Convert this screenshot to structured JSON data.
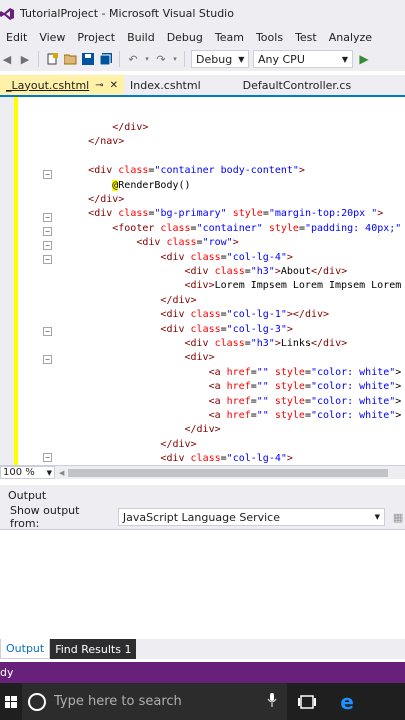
{
  "window": {
    "title": "TutorialProject - Microsoft Visual Studio"
  },
  "menu": [
    "Edit",
    "View",
    "Project",
    "Build",
    "Debug",
    "Team",
    "Tools",
    "Test",
    "Analyze"
  ],
  "toolbar": {
    "config": "Debug",
    "platform": "Any CPU",
    "icons": [
      "back-icon",
      "forward-icon",
      "new-project-icon",
      "open-icon",
      "save-icon",
      "save-all-icon",
      "undo-icon",
      "redo-icon",
      "start-icon"
    ]
  },
  "tabs": [
    {
      "label": "_Layout.cshtml",
      "pin": "⊸",
      "close": "✕"
    },
    {
      "label": "Index.cshtml"
    },
    {
      "label": "DefaultController.cs"
    }
  ],
  "code": [
    [
      [
        "tx",
        "            "
      ],
      [
        "tg",
        "</div>"
      ]
    ],
    [
      [
        "tx",
        "        "
      ],
      [
        "tg",
        "</nav>"
      ]
    ],
    [
      [
        "tx",
        ""
      ]
    ],
    [
      [
        "tx",
        "        "
      ],
      [
        "tg",
        "<div "
      ],
      [
        "at",
        "class"
      ],
      [
        "tx",
        "="
      ],
      [
        "av",
        "\"container body-content\""
      ],
      [
        "tg",
        ">"
      ]
    ],
    [
      [
        "tx",
        "            "
      ],
      [
        "rz",
        "@"
      ],
      [
        "tx",
        "RenderBody()"
      ]
    ],
    [
      [
        "tx",
        "        "
      ],
      [
        "tg",
        "</div>"
      ]
    ],
    [
      [
        "tx",
        "        "
      ],
      [
        "tg",
        "<div "
      ],
      [
        "at",
        "class"
      ],
      [
        "tx",
        "="
      ],
      [
        "av",
        "\"bg-primary\""
      ],
      [
        "tx",
        " "
      ],
      [
        "at",
        "style"
      ],
      [
        "tx",
        "="
      ],
      [
        "av",
        "\"margin-top:20px \""
      ],
      [
        "tg",
        ">"
      ]
    ],
    [
      [
        "tx",
        "            "
      ],
      [
        "tg",
        "<footer "
      ],
      [
        "at",
        "class"
      ],
      [
        "tx",
        "="
      ],
      [
        "av",
        "\"container\""
      ],
      [
        "tx",
        " "
      ],
      [
        "at",
        "style"
      ],
      [
        "tx",
        "="
      ],
      [
        "av",
        "\"padding: 40px;\""
      ]
    ],
    [
      [
        "tx",
        "                "
      ],
      [
        "tg",
        "<div "
      ],
      [
        "at",
        "class"
      ],
      [
        "tx",
        "="
      ],
      [
        "av",
        "\"row\""
      ],
      [
        "tg",
        ">"
      ]
    ],
    [
      [
        "tx",
        "                    "
      ],
      [
        "tg",
        "<div "
      ],
      [
        "at",
        "class"
      ],
      [
        "tx",
        "="
      ],
      [
        "av",
        "\"col-lg-4\""
      ],
      [
        "tg",
        ">"
      ]
    ],
    [
      [
        "tx",
        "                        "
      ],
      [
        "tg",
        "<div "
      ],
      [
        "at",
        "class"
      ],
      [
        "tx",
        "="
      ],
      [
        "av",
        "\"h3\""
      ],
      [
        "tg",
        ">"
      ],
      [
        "tx",
        "About"
      ],
      [
        "tg",
        "</div>"
      ]
    ],
    [
      [
        "tx",
        "                        "
      ],
      [
        "tg",
        "<div>"
      ],
      [
        "tx",
        "Lorem Impsem Lorem Impsem Lorem"
      ]
    ],
    [
      [
        "tx",
        "                    "
      ],
      [
        "tg",
        "</div>"
      ]
    ],
    [
      [
        "tx",
        "                    "
      ],
      [
        "tg",
        "<div "
      ],
      [
        "at",
        "class"
      ],
      [
        "tx",
        "="
      ],
      [
        "av",
        "\"col-lg-1\""
      ],
      [
        "tg",
        "></div>"
      ]
    ],
    [
      [
        "tx",
        "                    "
      ],
      [
        "tg",
        "<div "
      ],
      [
        "at",
        "class"
      ],
      [
        "tx",
        "="
      ],
      [
        "av",
        "\"col-lg-3\""
      ],
      [
        "tg",
        ">"
      ]
    ],
    [
      [
        "tx",
        "                        "
      ],
      [
        "tg",
        "<div "
      ],
      [
        "at",
        "class"
      ],
      [
        "tx",
        "="
      ],
      [
        "av",
        "\"h3\""
      ],
      [
        "tg",
        ">"
      ],
      [
        "tx",
        "Links"
      ],
      [
        "tg",
        "</div>"
      ]
    ],
    [
      [
        "tx",
        "                        "
      ],
      [
        "tg",
        "<div>"
      ]
    ],
    [
      [
        "tx",
        "                            "
      ],
      [
        "tg",
        "<a "
      ],
      [
        "at",
        "href"
      ],
      [
        "tx",
        "="
      ],
      [
        "av",
        "\"\""
      ],
      [
        "tx",
        " "
      ],
      [
        "at",
        "style"
      ],
      [
        "tx",
        "="
      ],
      [
        "av",
        "\"color: white\""
      ],
      [
        "tx",
        ">"
      ]
    ],
    [
      [
        "tx",
        "                            "
      ],
      [
        "tg",
        "<a "
      ],
      [
        "at",
        "href"
      ],
      [
        "tx",
        "="
      ],
      [
        "av",
        "\"\""
      ],
      [
        "tx",
        " "
      ],
      [
        "at",
        "style"
      ],
      [
        "tx",
        "="
      ],
      [
        "av",
        "\"color: white\""
      ],
      [
        "tx",
        ">"
      ]
    ],
    [
      [
        "tx",
        "                            "
      ],
      [
        "tg",
        "<a "
      ],
      [
        "at",
        "href"
      ],
      [
        "tx",
        "="
      ],
      [
        "av",
        "\"\""
      ],
      [
        "tx",
        " "
      ],
      [
        "at",
        "style"
      ],
      [
        "tx",
        "="
      ],
      [
        "av",
        "\"color: white\""
      ],
      [
        "tx",
        ">"
      ]
    ],
    [
      [
        "tx",
        "                            "
      ],
      [
        "tg",
        "<a "
      ],
      [
        "at",
        "href"
      ],
      [
        "tx",
        "="
      ],
      [
        "av",
        "\"\""
      ],
      [
        "tx",
        " "
      ],
      [
        "at",
        "style"
      ],
      [
        "tx",
        "="
      ],
      [
        "av",
        "\"color: white\""
      ],
      [
        "tx",
        ">"
      ]
    ],
    [
      [
        "tx",
        "                        "
      ],
      [
        "tg",
        "</div>"
      ]
    ],
    [
      [
        "tx",
        "                    "
      ],
      [
        "tg",
        "</div>"
      ]
    ],
    [
      [
        "tx",
        "                    "
      ],
      [
        "tg",
        "<div "
      ],
      [
        "at",
        "class"
      ],
      [
        "tx",
        "="
      ],
      [
        "av",
        "\"col-lg-4\""
      ],
      [
        "tg",
        ">"
      ]
    ]
  ],
  "editor": {
    "zoom": "100 %"
  },
  "output": {
    "title": "Output",
    "show_from_label": "Show output from:",
    "source": "JavaScript Language Service"
  },
  "bottom_tabs": [
    "Output",
    "Find Results 1"
  ],
  "status": {
    "text": "dy"
  },
  "taskbar": {
    "search_placeholder": "Type here to search"
  },
  "colors": {
    "accent": "#007acc",
    "status": "#68217a",
    "tag": "#800000",
    "attr": "#ff0000",
    "value": "#0000ff",
    "active_tab": "#fff1a8"
  }
}
